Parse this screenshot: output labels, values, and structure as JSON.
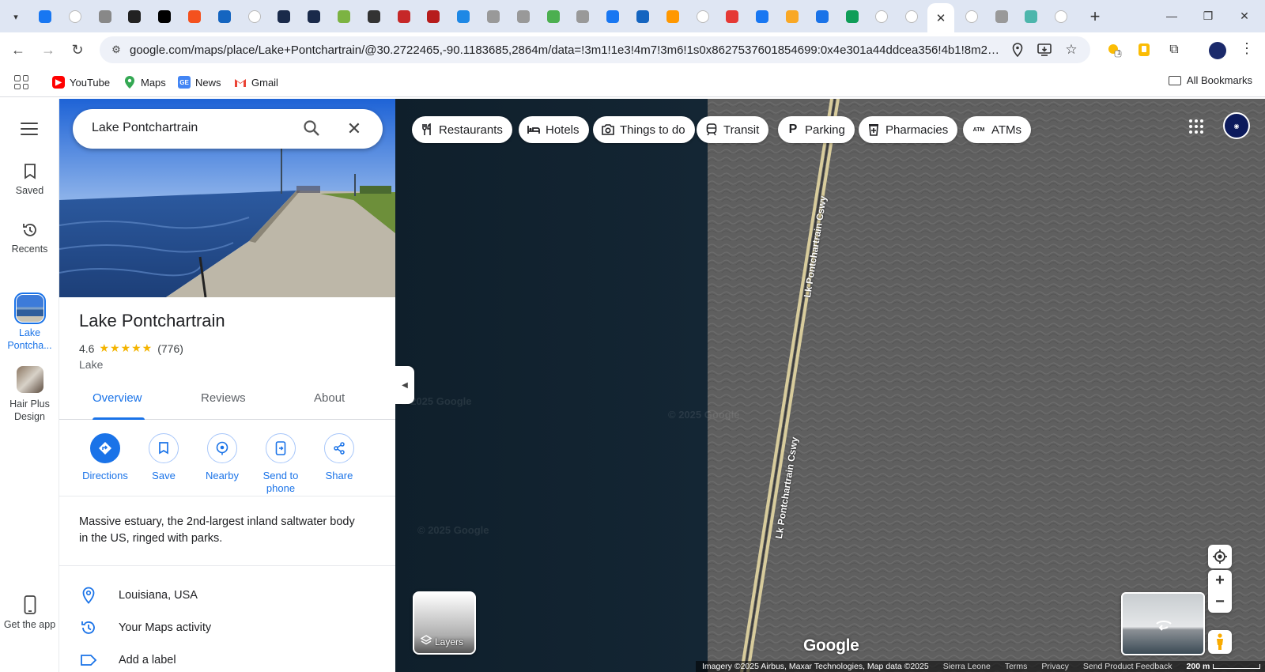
{
  "browser": {
    "tabs_count": 36,
    "url": "google.com/maps/place/Lake+Pontchartrain/@30.2722465,-90.1183685,2864m/data=!3m1!1e3!4m7!3m6!1s0x8627537601854699:0x4e301a44ddcea356!4b1!8m2!3d30.2...",
    "bookmarks": [
      {
        "label": "YouTube",
        "icon": "youtube-icon",
        "color": "#ff0000"
      },
      {
        "label": "Maps",
        "icon": "maps-pin-icon",
        "color": "#34a853"
      },
      {
        "label": "News",
        "icon": "news-icon",
        "color": "#4285f4"
      },
      {
        "label": "Gmail",
        "icon": "gmail-icon",
        "color": "#ea4335"
      }
    ],
    "all_bookmarks": "All Bookmarks",
    "extension_badge": "1"
  },
  "rail": {
    "items": [
      {
        "label": "Saved",
        "icon": "bookmark-icon"
      },
      {
        "label": "Recents",
        "icon": "history-icon"
      },
      {
        "label": "Lake Pontcha...",
        "icon": "thumbnail"
      },
      {
        "label": "Hair Plus Design",
        "icon": "thumbnail"
      }
    ],
    "get_app": "Get the app"
  },
  "search": {
    "value": "Lake Pontchartrain"
  },
  "place": {
    "title": "Lake Pontchartrain",
    "rating": "4.6",
    "stars": "★★★★★",
    "reviews": "(776)",
    "type": "Lake",
    "tabs": [
      "Overview",
      "Reviews",
      "About"
    ],
    "actions": [
      {
        "label": "Directions",
        "icon": "directions-icon"
      },
      {
        "label": "Save",
        "icon": "bookmark-icon"
      },
      {
        "label": "Nearby",
        "icon": "nearby-icon"
      },
      {
        "label": "Send to phone",
        "icon": "send-to-phone-icon"
      },
      {
        "label": "Share",
        "icon": "share-icon"
      }
    ],
    "description": "Massive estuary, the 2nd-largest inland saltwater body in the US, ringed with parks.",
    "info": [
      {
        "text": "Louisiana, USA",
        "icon": "location-pin-icon"
      },
      {
        "text": "Your Maps activity",
        "icon": "history-icon"
      },
      {
        "text": "Add a label",
        "icon": "label-icon"
      }
    ]
  },
  "map": {
    "chips": [
      {
        "label": "Restaurants",
        "icon": "fork-knife-icon"
      },
      {
        "label": "Hotels",
        "icon": "bed-icon"
      },
      {
        "label": "Things to do",
        "icon": "camera-icon"
      },
      {
        "label": "Transit",
        "icon": "train-icon"
      },
      {
        "label": "Parking",
        "icon": "parking-icon"
      },
      {
        "label": "Pharmacies",
        "icon": "pharmacy-icon"
      },
      {
        "label": "ATMs",
        "icon": "atm-icon"
      }
    ],
    "atm_glyph": "ATM",
    "parking_glyph": "P",
    "road_label": "Lk Pontchartrain Cswy",
    "layers_label": "Layers",
    "logo": "Google",
    "watermark": "© 2025 Google",
    "attribution": "Imagery ©2025 Airbus, Maxar Technologies, Map data ©2025",
    "footer_links": [
      "Sierra Leone",
      "Terms",
      "Privacy",
      "Send Product Feedback"
    ],
    "scale": "200 m",
    "colors": {
      "water_dark": "#0f1f2b",
      "water_gray": "#5e5e5e",
      "road": "#e3d6a6"
    }
  }
}
